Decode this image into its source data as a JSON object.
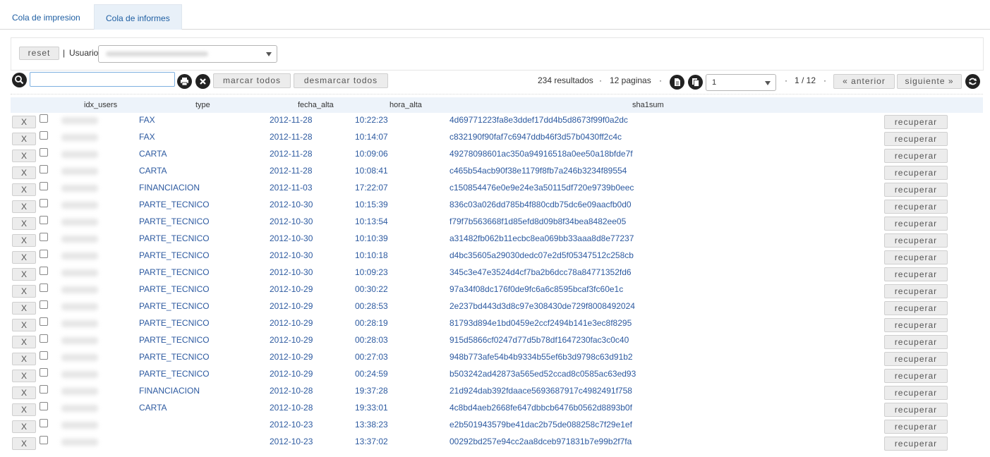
{
  "tabs": [
    {
      "label": "Cola de impresion"
    },
    {
      "label": "Cola de informes"
    }
  ],
  "filter": {
    "reset_label": "reset",
    "separator": "|",
    "user_label": "Usuario"
  },
  "toolbar": {
    "marcar_label": "marcar todos",
    "desmarcar_label": "desmarcar todos",
    "results": "234 resultados",
    "pages": "12 paginas",
    "dot": "·",
    "page_value": "1",
    "page_of": "1 / 12",
    "anterior_label": "« anterior",
    "siguiente_label": "siguiente »"
  },
  "icons": {
    "search": "search-icon",
    "print": "print-icon",
    "clear": "close-icon",
    "pdf": "pdf-icon",
    "copy": "copy-icon",
    "refresh": "refresh-icon"
  },
  "table": {
    "columns": [
      "idx_users",
      "type",
      "fecha_alta",
      "hora_alta",
      "sha1sum"
    ],
    "delete_label": "X",
    "recover_label": "recuperar",
    "rows": [
      {
        "type": "FAX",
        "fecha": "2012-11-28",
        "hora": "10:22:23",
        "sha": "4d69771223fa8e3ddef17dd4b5d8673f99f0a2dc"
      },
      {
        "type": "FAX",
        "fecha": "2012-11-28",
        "hora": "10:14:07",
        "sha": "c832190f90faf7c6947ddb46f3d57b0430ff2c4c"
      },
      {
        "type": "CARTA",
        "fecha": "2012-11-28",
        "hora": "10:09:06",
        "sha": "49278098601ac350a94916518a0ee50a18bfde7f"
      },
      {
        "type": "CARTA",
        "fecha": "2012-11-28",
        "hora": "10:08:41",
        "sha": "c465b54acb90f38e1179f8fb7a246b3234f89554"
      },
      {
        "type": "FINANCIACION",
        "fecha": "2012-11-03",
        "hora": "17:22:07",
        "sha": "c150854476e0e9e24e3a50115df720e9739b0eec"
      },
      {
        "type": "PARTE_TECNICO",
        "fecha": "2012-10-30",
        "hora": "10:15:39",
        "sha": "836c03a026dd785b4f880cdb75dc6e09aacfb0d0"
      },
      {
        "type": "PARTE_TECNICO",
        "fecha": "2012-10-30",
        "hora": "10:13:54",
        "sha": "f79f7b563668f1d85efd8d09b8f34bea8482ee05"
      },
      {
        "type": "PARTE_TECNICO",
        "fecha": "2012-10-30",
        "hora": "10:10:39",
        "sha": "a31482fb062b11ecbc8ea069bb33aaa8d8e77237"
      },
      {
        "type": "PARTE_TECNICO",
        "fecha": "2012-10-30",
        "hora": "10:10:18",
        "sha": "d4bc35605a29030dedc07e2d5f05347512c258cb"
      },
      {
        "type": "PARTE_TECNICO",
        "fecha": "2012-10-30",
        "hora": "10:09:23",
        "sha": "345c3e47e3524d4cf7ba2b6dcc78a84771352fd6"
      },
      {
        "type": "PARTE_TECNICO",
        "fecha": "2012-10-29",
        "hora": "00:30:22",
        "sha": "97a34f08dc176f0de9fc6a6c8595bcaf3fc60e1c"
      },
      {
        "type": "PARTE_TECNICO",
        "fecha": "2012-10-29",
        "hora": "00:28:53",
        "sha": "2e237bd443d3d8c97e308430de729f8008492024"
      },
      {
        "type": "PARTE_TECNICO",
        "fecha": "2012-10-29",
        "hora": "00:28:19",
        "sha": "81793d894e1bd0459e2ccf2494b141e3ec8f8295"
      },
      {
        "type": "PARTE_TECNICO",
        "fecha": "2012-10-29",
        "hora": "00:28:03",
        "sha": "915d5866cf0247d77d5b78df1647230fac3c0c40"
      },
      {
        "type": "PARTE_TECNICO",
        "fecha": "2012-10-29",
        "hora": "00:27:03",
        "sha": "948b773afe54b4b9334b55ef6b3d9798c63d91b2"
      },
      {
        "type": "PARTE_TECNICO",
        "fecha": "2012-10-29",
        "hora": "00:24:59",
        "sha": "b503242ad42873a565ed52ccad8c0585ac63ed93"
      },
      {
        "type": "FINANCIACION",
        "fecha": "2012-10-28",
        "hora": "19:37:28",
        "sha": "21d924dab392fdaace5693687917c4982491f758"
      },
      {
        "type": "CARTA",
        "fecha": "2012-10-28",
        "hora": "19:33:01",
        "sha": "4c8bd4aeb2668fe647dbbcb6476b0562d8893b0f"
      },
      {
        "type": "",
        "fecha": "2012-10-23",
        "hora": "13:38:23",
        "sha": "e2b501943579be41dac2b75de088258c7f29e1ef"
      },
      {
        "type": "",
        "fecha": "2012-10-23",
        "hora": "13:37:02",
        "sha": "00292bd257e94cc2aa8dceb971831b7e99b2f7fa"
      }
    ]
  },
  "colors": {
    "link": "#2d5aa0",
    "tab_active_bg": "#e8f0f8",
    "header_bg": "#edf3fa",
    "button_bg": "#ececec"
  }
}
